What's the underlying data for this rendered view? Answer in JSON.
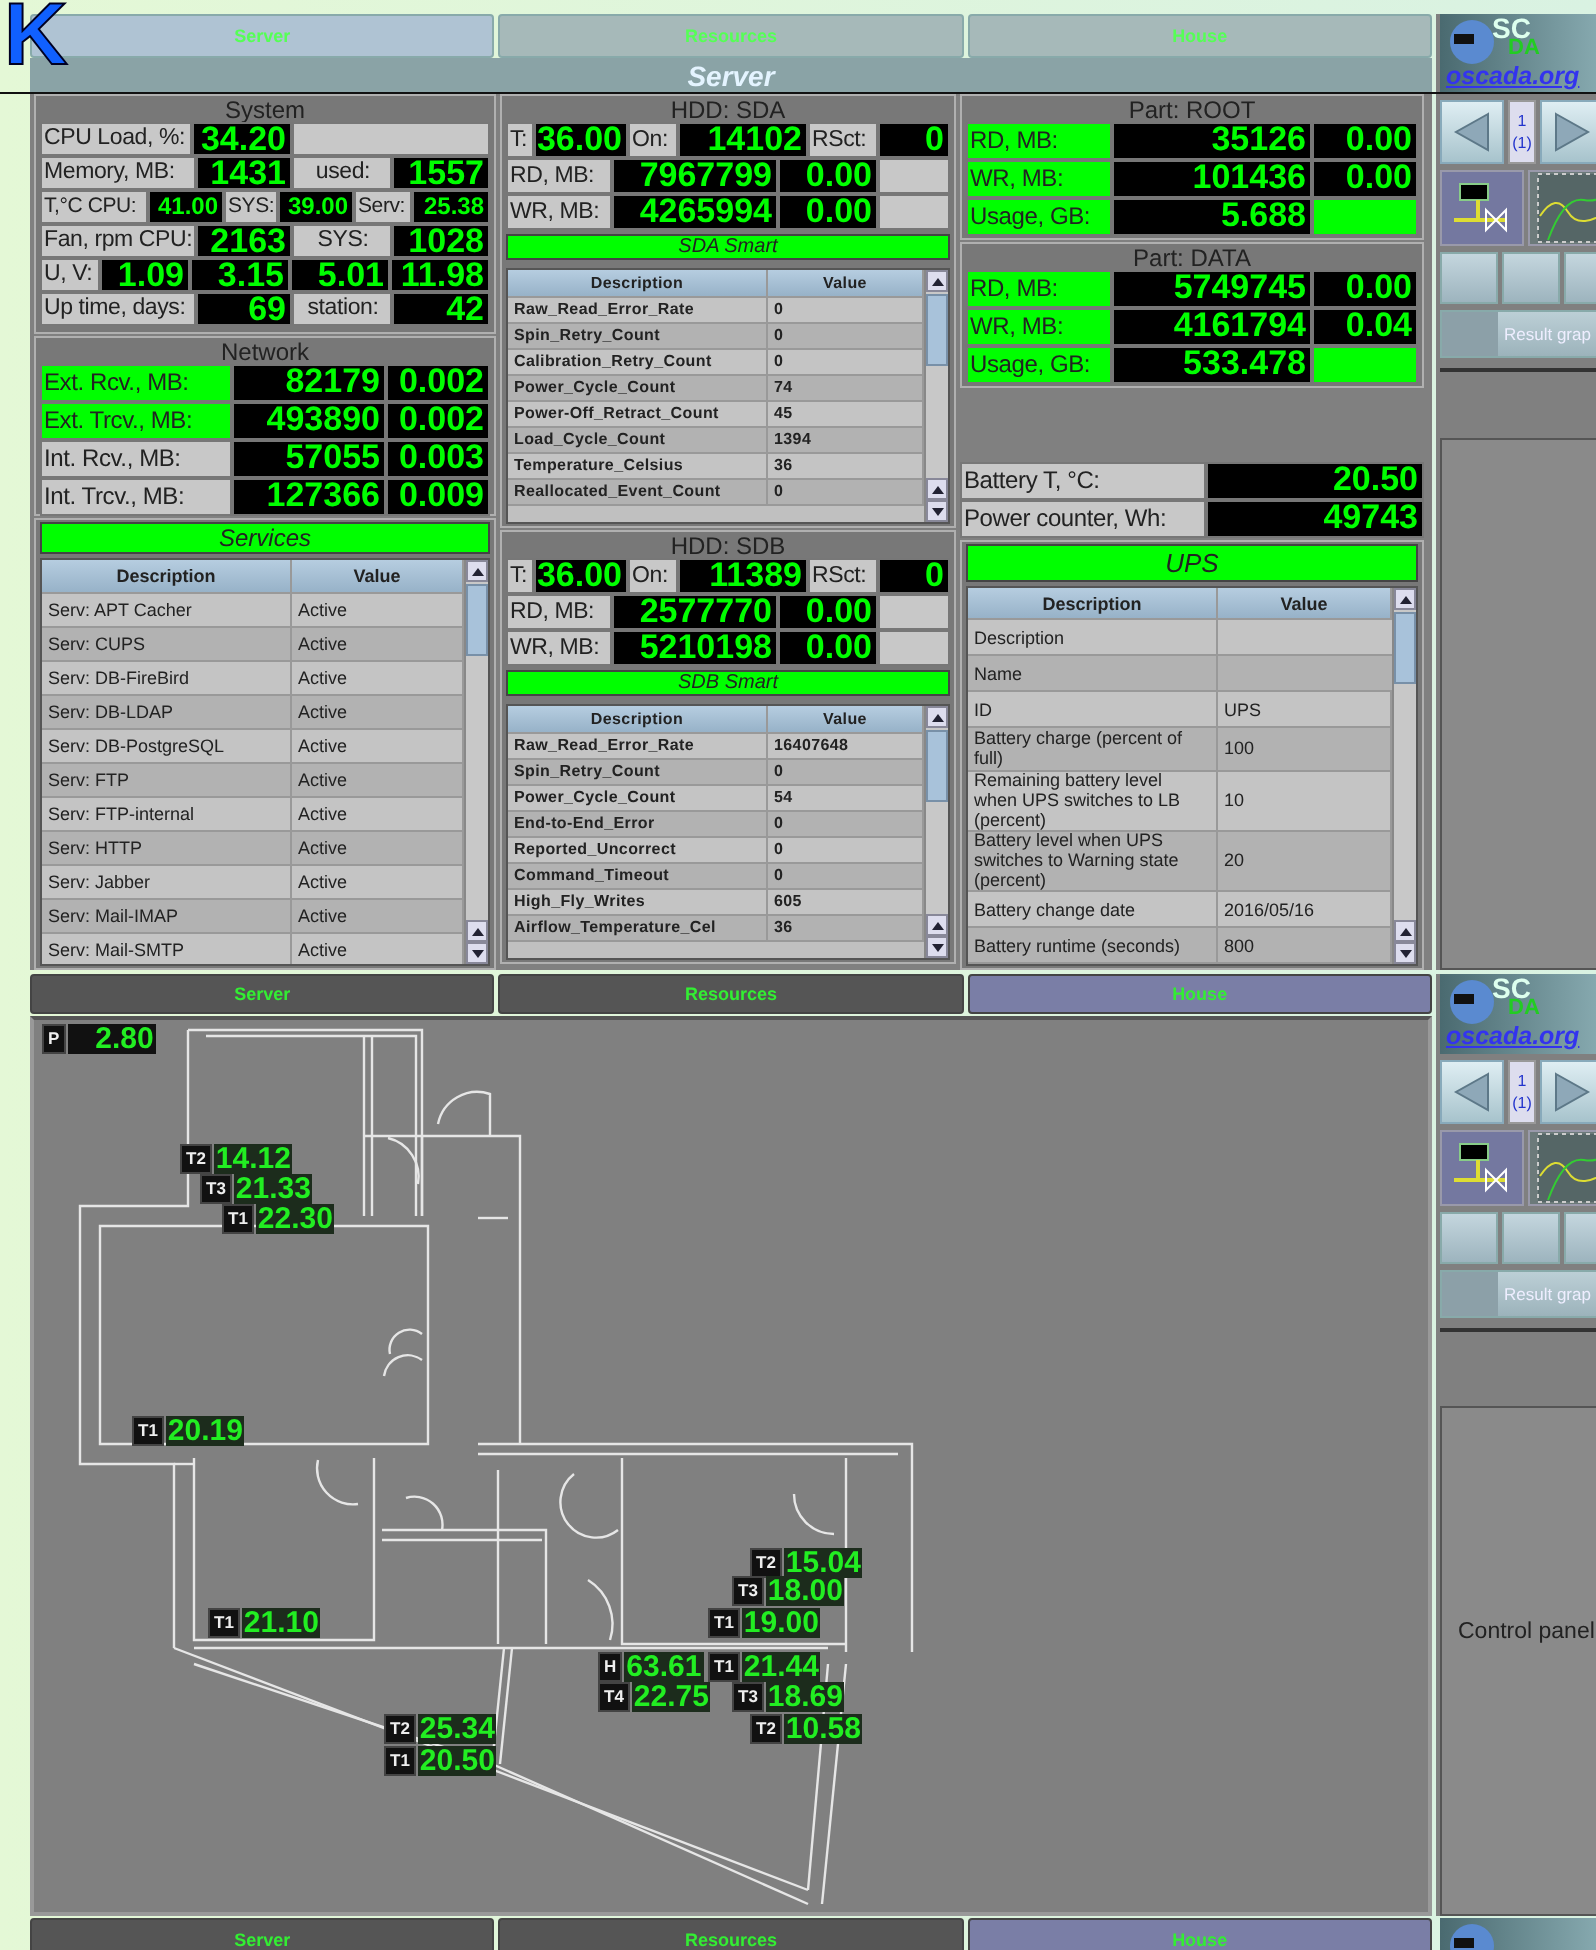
{
  "overlay_text": "K",
  "views": [
    {
      "kind": "server",
      "tabs": [
        {
          "label": "Server",
          "selected": true
        },
        {
          "label": "Resources",
          "selected": false
        },
        {
          "label": "House",
          "selected": false
        }
      ],
      "title": "Server",
      "system": {
        "title": "System",
        "rows": [
          {
            "kind": "single",
            "label": "CPU Load, %:",
            "value": "34.20"
          },
          {
            "kind": "pair",
            "label": "Memory, MB:",
            "value": "1431",
            "label2": "used:",
            "value2": "1557"
          },
          {
            "kind": "triple",
            "label": "T,°C  CPU:",
            "value": "41.00",
            "label2": "SYS:",
            "value2": "39.00",
            "label3": "Serv:",
            "value3": "25.38"
          },
          {
            "kind": "pair",
            "label": "Fan, rpm CPU:",
            "value": "2163",
            "label2": "SYS:",
            "value2": "1028"
          },
          {
            "kind": "readings",
            "label": "U, V:",
            "readings": [
              "1.09",
              "3.15",
              "5.01",
              "11.98"
            ]
          },
          {
            "kind": "pair",
            "label": "Up time, days:",
            "value": "69",
            "label2": "station:",
            "value2": "42"
          }
        ]
      },
      "network": {
        "title": "Network",
        "rows": [
          {
            "label": "Ext. Rcv., MB:",
            "highlighted": true,
            "value": "82179",
            "rate": "0.002"
          },
          {
            "label": "Ext. Trcv., MB:",
            "highlighted": true,
            "value": "493890",
            "rate": "0.002"
          },
          {
            "label": "Int. Rcv., MB:",
            "highlighted": false,
            "value": "57055",
            "rate": "0.003"
          },
          {
            "label": "Int. Trcv., MB:",
            "highlighted": false,
            "value": "127366",
            "rate": "0.009"
          }
        ]
      },
      "services": {
        "title": "Services",
        "columns": [
          "Description",
          "Value"
        ],
        "rows": [
          [
            "Serv: APT Cacher",
            "Active"
          ],
          [
            "Serv: CUPS",
            "Active"
          ],
          [
            "Serv: DB-FireBird",
            "Active"
          ],
          [
            "Serv: DB-LDAP",
            "Active"
          ],
          [
            "Serv: DB-PostgreSQL",
            "Active"
          ],
          [
            "Serv: FTP",
            "Active"
          ],
          [
            "Serv: FTP-internal",
            "Active"
          ],
          [
            "Serv: HTTP",
            "Active"
          ],
          [
            "Serv: Jabber",
            "Active"
          ],
          [
            "Serv: Mail-IMAP",
            "Active"
          ],
          [
            "Serv: Mail-SMTP",
            "Active"
          ]
        ]
      },
      "disks": [
        {
          "title": "HDD: SDA",
          "temp_label": "T:",
          "temp": "36.00",
          "on_label": "On:",
          "on": "14102",
          "rsct_label": "RSct:",
          "rsct": "0",
          "rows": [
            {
              "label": "RD, MB:",
              "value": "7967799",
              "rate": "0.00"
            },
            {
              "label": "WR, MB:",
              "value": "4265994",
              "rate": "0.00"
            }
          ],
          "smart_title": "SDA Smart",
          "columns": [
            "Description",
            "Value"
          ],
          "smart_rows": [
            [
              "Raw_Read_Error_Rate",
              "0"
            ],
            [
              "Spin_Retry_Count",
              "0"
            ],
            [
              "Calibration_Retry_Count",
              "0"
            ],
            [
              "Power_Cycle_Count",
              "74"
            ],
            [
              "Power-Off_Retract_Count",
              "45"
            ],
            [
              "Load_Cycle_Count",
              "1394"
            ],
            [
              "Temperature_Celsius",
              "36"
            ],
            [
              "Reallocated_Event_Count",
              "0"
            ]
          ]
        },
        {
          "title": "HDD: SDB",
          "temp_label": "T:",
          "temp": "36.00",
          "on_label": "On:",
          "on": "11389",
          "rsct_label": "RSct:",
          "rsct": "0",
          "rows": [
            {
              "label": "RD, MB:",
              "value": "2577770",
              "rate": "0.00"
            },
            {
              "label": "WR, MB:",
              "value": "5210198",
              "rate": "0.00"
            }
          ],
          "smart_title": "SDB Smart",
          "columns": [
            "Description",
            "Value"
          ],
          "smart_rows": [
            [
              "Raw_Read_Error_Rate",
              "16407648"
            ],
            [
              "Spin_Retry_Count",
              "0"
            ],
            [
              "Power_Cycle_Count",
              "54"
            ],
            [
              "End-to-End_Error",
              "0"
            ],
            [
              "Reported_Uncorrect",
              "0"
            ],
            [
              "Command_Timeout",
              "0"
            ],
            [
              "High_Fly_Writes",
              "605"
            ],
            [
              "Airflow_Temperature_Cel",
              "36"
            ]
          ]
        }
      ],
      "partitions": [
        {
          "title": "Part: ROOT",
          "rows": [
            {
              "label": "RD, MB:",
              "highlighted": true,
              "value": "35126",
              "rate": "0.00"
            },
            {
              "label": "WR, MB:",
              "highlighted": true,
              "value": "101436",
              "rate": "0.00"
            },
            {
              "label": "Usage, GB:",
              "highlighted": true,
              "value": "5.688"
            }
          ]
        },
        {
          "title": "Part: DATA",
          "rows": [
            {
              "label": "RD, MB:",
              "highlighted": true,
              "value": "5749745",
              "rate": "0.00"
            },
            {
              "label": "WR, MB:",
              "highlighted": true,
              "value": "4161794",
              "rate": "0.04"
            },
            {
              "label": "Usage, GB:",
              "highlighted": true,
              "value": "533.478"
            }
          ]
        }
      ],
      "power": [
        {
          "label": "Battery T, °C:",
          "value": "20.50"
        },
        {
          "label": "Power counter, Wh:",
          "value": "49743"
        }
      ],
      "ups": {
        "title": "UPS",
        "columns": [
          "Description",
          "Value"
        ],
        "rows": [
          {
            "description": "Description"
          },
          {
            "description": "Name"
          },
          {
            "description": "ID",
            "value": "UPS"
          },
          {
            "description": "Battery charge (percent of full)",
            "value": "100"
          },
          {
            "description": "Remaining battery level when UPS switches to LB (percent)",
            "value": "10"
          },
          {
            "description": "Battery level when UPS switches to Warning state (percent)",
            "value": "20"
          },
          {
            "description": "Battery change date",
            "value": "2016/05/16"
          },
          {
            "description": "Battery runtime (seconds)",
            "value": "800"
          }
        ]
      },
      "sidebar": {
        "kind": "full",
        "logo_top": "SC",
        "logo_mid": "DA",
        "site": "oscada.org",
        "page": "1",
        "page_total": "(1)",
        "result_button": "Result grap"
      }
    },
    {
      "kind": "house",
      "tabs": [
        {
          "label": "Server",
          "selected": false
        },
        {
          "label": "Resources",
          "selected": false
        },
        {
          "label": "House",
          "selected": true
        }
      ],
      "sensors": [
        {
          "tag": "P",
          "value": "2.80"
        },
        {
          "tag": "T2",
          "value": "14.12"
        },
        {
          "tag": "T3",
          "value": "21.33"
        },
        {
          "tag": "T1",
          "value": "22.30"
        },
        {
          "tag": "T1",
          "value": "20.19"
        },
        {
          "tag": "T2",
          "value": "15.04"
        },
        {
          "tag": "T3",
          "value": "18.00"
        },
        {
          "tag": "T1",
          "value": "21.10"
        },
        {
          "tag": "T1",
          "value": "19.00"
        },
        {
          "tag": "H",
          "value": "63.61"
        },
        {
          "tag": "T1",
          "value": "21.44"
        },
        {
          "tag": "T4",
          "value": "22.75"
        },
        {
          "tag": "T3",
          "value": "18.69"
        },
        {
          "tag": "T2",
          "value": "25.34"
        },
        {
          "tag": "T2",
          "value": "10.58"
        },
        {
          "tag": "T1",
          "value": "20.50"
        }
      ],
      "sidebar": {
        "kind": "full",
        "logo_top": "SC",
        "logo_mid": "DA",
        "site": "oscada.org",
        "page": "1",
        "page_total": "(1)",
        "result_button": "Result grap",
        "panel_text": "Control panel"
      }
    },
    {
      "kind": "strip",
      "tabs": [
        {
          "label": "Server",
          "selected": false
        },
        {
          "label": "Resources",
          "selected": false
        },
        {
          "label": "House",
          "selected": true
        }
      ],
      "sidebar": {
        "kind": "logo"
      }
    }
  ]
}
